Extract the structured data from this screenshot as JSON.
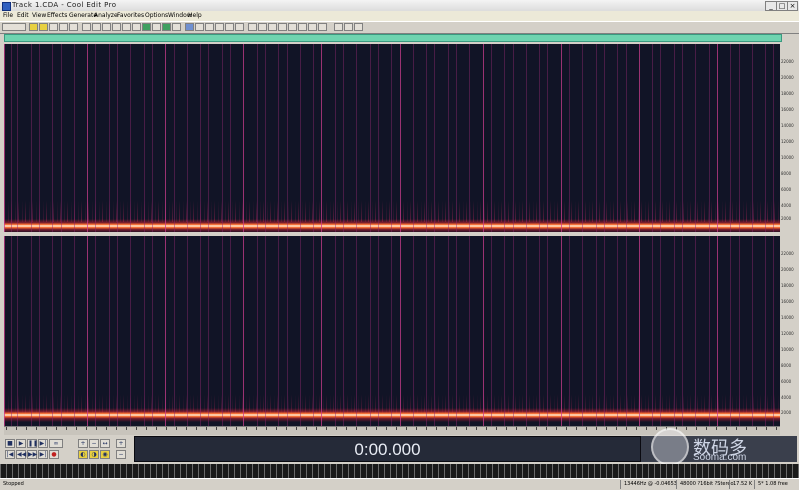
{
  "window": {
    "title": "Track 1.CDA - Cool Edit Pro",
    "minimize": "_",
    "maximize": "□",
    "close": "×"
  },
  "menu": [
    "File",
    "Edit",
    "View",
    "Effects",
    "Generate",
    "Analyze",
    "Favorites",
    "Options",
    "Window",
    "Help"
  ],
  "transport": {
    "time": "0:00.000"
  },
  "status": {
    "state": "Stopped",
    "freq": "13446Hz @ -0.04653",
    "format": "48000 ?16bit ?Stereo",
    "size": "17.52 K",
    "free": "5* 1.08 free"
  },
  "watermark": {
    "cn": "数码多",
    "en": "Sooma.com"
  },
  "hz_labels": [
    "22000",
    "20000",
    "18000",
    "16000",
    "14000",
    "12000",
    "10000",
    "8000",
    "6000",
    "4000",
    "2000"
  ]
}
